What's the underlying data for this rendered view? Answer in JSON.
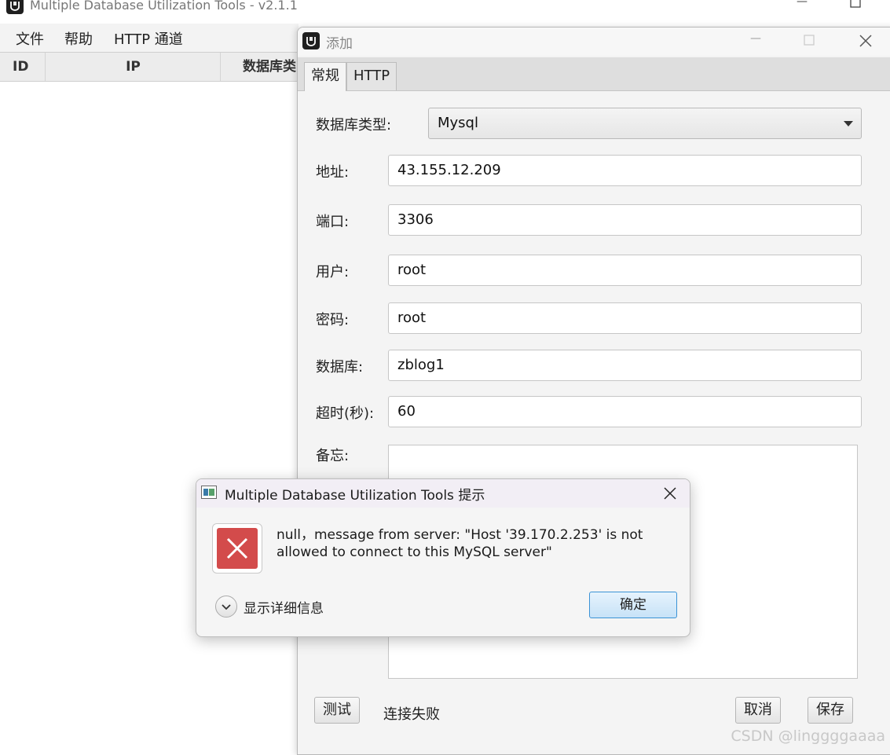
{
  "main_window": {
    "title": "Multiple Database Utilization Tools - v2.1.1",
    "menu": [
      "文件",
      "帮助",
      "HTTP 通道"
    ],
    "table_headers": [
      "ID",
      "IP",
      "数据库类"
    ]
  },
  "add_dialog": {
    "title": "添加",
    "tabs": [
      "常规",
      "HTTP"
    ],
    "fields": {
      "db_type": {
        "label": "数据库类型:",
        "value": "Mysql"
      },
      "address": {
        "label": "地址:",
        "value": "43.155.12.209"
      },
      "port": {
        "label": "端口:",
        "value": "3306"
      },
      "user": {
        "label": "用户:",
        "value": "root"
      },
      "password": {
        "label": "密码:",
        "value": "root"
      },
      "database": {
        "label": "数据库:",
        "value": "zblog1"
      },
      "timeout": {
        "label": "超时(秒):",
        "value": "60"
      },
      "memo": {
        "label": "备忘:",
        "value": ""
      }
    },
    "buttons": {
      "test": "测试",
      "cancel": "取消",
      "save": "保存"
    },
    "status": "连接失败"
  },
  "alert": {
    "title": "Multiple Database Utilization Tools 提示",
    "message": "null，message from server: \"Host '39.170.2.253' is not allowed to connect to this MySQL server\"",
    "details_toggle": "显示详细信息",
    "ok": "确定"
  },
  "watermark": "CSDN @linggggaaaa",
  "icons": [
    "app-logo-icon",
    "minimize-icon",
    "maximize-icon",
    "close-icon",
    "error-icon",
    "chevron-down-icon",
    "dropdown-caret-icon"
  ],
  "colors": {
    "error_red": "#d34b4b",
    "ok_border": "#3b93d6"
  }
}
